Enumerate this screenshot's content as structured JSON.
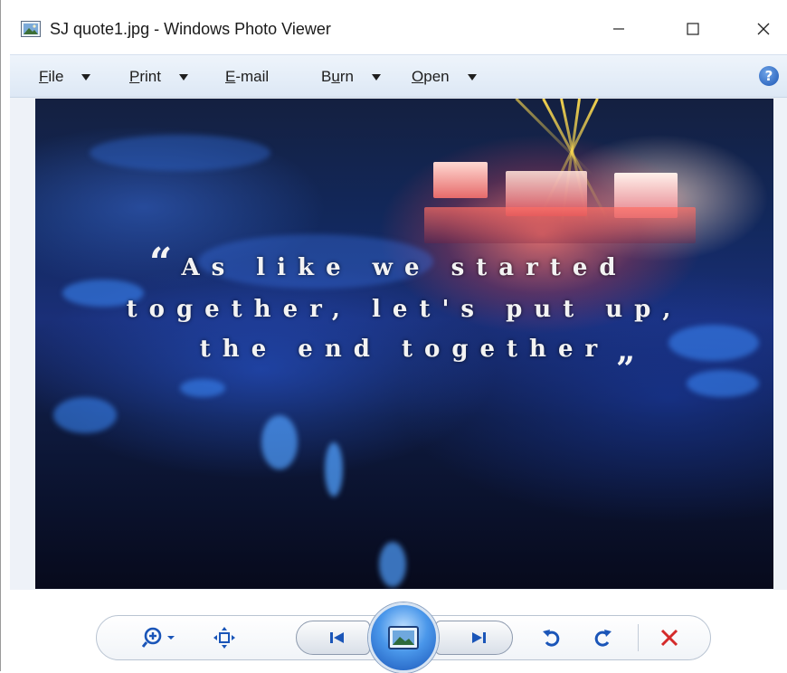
{
  "window": {
    "title": "SJ quote1.jpg - Windows Photo Viewer",
    "controls": {
      "minimize": "—",
      "maximize": "☐",
      "close": "✕"
    }
  },
  "menu": {
    "items": [
      {
        "prefix": "",
        "underlined": "F",
        "rest": "ile",
        "has_dropdown": true
      },
      {
        "prefix": "",
        "underlined": "P",
        "rest": "rint",
        "has_dropdown": true
      },
      {
        "prefix": "",
        "underlined": "E",
        "rest": "-mail",
        "has_dropdown": false
      },
      {
        "prefix": "B",
        "underlined": "u",
        "rest": "rn",
        "has_dropdown": true
      },
      {
        "prefix": "",
        "underlined": "O",
        "rest": "pen",
        "has_dropdown": true
      }
    ],
    "help_glyph": "?"
  },
  "photo": {
    "quote_open": "“",
    "line1": "As like we started",
    "line2": "together, let's put up,",
    "line3": "the end together",
    "quote_close": "”"
  },
  "toolbar": {
    "icons": [
      "zoom-in-icon",
      "actual-size-icon",
      "previous-icon",
      "slideshow-icon",
      "next-icon",
      "rotate-counterclockwise-icon",
      "rotate-clockwise-icon",
      "delete-icon"
    ],
    "accent_blue": "#1a55b8",
    "delete_red": "#d42a2a"
  }
}
